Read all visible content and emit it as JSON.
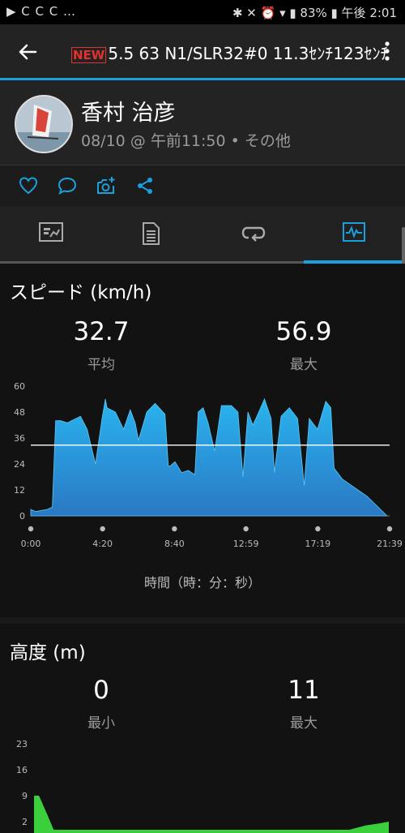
{
  "status_bar": {
    "left_icons": "▶ C C C …",
    "battery": "83%",
    "time": "午後 2:01"
  },
  "app_bar": {
    "badge": "NEW",
    "title": "5.5 63 N1/SLR32#0 11.3ｾﾝﾁ123ｾﾝﾁ"
  },
  "activity": {
    "user_name": "香村 治彦",
    "subtitle": "08/10 @ 午前11:50 • その他"
  },
  "actions": [
    "heart-icon",
    "comment-icon",
    "camera-add-icon",
    "share-icon"
  ],
  "tabs": [
    {
      "icon": "summary-icon",
      "active": false
    },
    {
      "icon": "details-icon",
      "active": false
    },
    {
      "icon": "laps-icon",
      "active": false
    },
    {
      "icon": "charts-icon",
      "active": true
    }
  ],
  "speed": {
    "title": "スピード (km/h)",
    "avg_value": "32.7",
    "avg_label": "平均",
    "max_value": "56.9",
    "max_label": "最大",
    "x_axis_label": "時間（時：分：秒）"
  },
  "altitude": {
    "title": "高度 (m)",
    "min_value": "0",
    "min_label": "最小",
    "max_value": "11",
    "max_label": "最大"
  },
  "colors": {
    "accent": "#1aa0dc",
    "speed_fill": "#2a8fd0",
    "altitude_fill": "#3ccf3c"
  },
  "chart_data": [
    {
      "type": "area",
      "ylim": [
        0,
        60
      ],
      "yticks": [
        "0",
        "12",
        "24",
        "36",
        "48",
        "60"
      ],
      "xticks": [
        "0:00",
        "4:20",
        "8:40",
        "12:59",
        "17:19",
        "21:39"
      ],
      "x_minutes": [
        0,
        0.3,
        1,
        1.3,
        1.5,
        1.8,
        2.2,
        3.0,
        3.4,
        3.9,
        4.3,
        4.5,
        4.6,
        5.1,
        5.6,
        6.0,
        6.3,
        6.5,
        7.0,
        7.5,
        8.1,
        8.3,
        8.4,
        8.7,
        9.1,
        9.5,
        9.9,
        10.1,
        10.4,
        10.7,
        11.1,
        11.5,
        12.1,
        12.5,
        12.8,
        13.1,
        13.4,
        13.7,
        14.1,
        14.5,
        14.7,
        15.1,
        15.6,
        16.1,
        16.5,
        16.8,
        17.3,
        17.8,
        18.1,
        18.3,
        18.8,
        20.3,
        21.5
      ],
      "y_kmh": [
        3,
        2,
        3,
        4,
        44,
        44,
        43,
        46,
        40,
        24,
        45,
        54,
        50,
        48,
        40,
        49,
        43,
        35,
        48,
        52,
        47,
        23,
        23,
        25,
        20,
        21,
        19,
        48,
        50,
        43,
        30,
        51,
        51,
        48,
        18,
        48,
        42,
        47,
        54,
        45,
        20,
        46,
        50,
        45,
        14,
        45,
        40,
        53,
        50,
        22,
        17,
        9,
        0
      ],
      "reference_line": 32.7
    },
    {
      "type": "area",
      "ylim": [
        0,
        23
      ],
      "yticks": [
        "2",
        "9",
        "16",
        "23"
      ],
      "x_minutes": [
        0,
        0.3,
        0.8,
        1.2,
        1.4,
        2.0,
        4.0,
        8.0,
        12.0,
        16.0,
        18.0,
        19.2,
        20.2,
        21.0,
        21.6
      ],
      "y_m": [
        9,
        9,
        4,
        0,
        0,
        0,
        0,
        0,
        0,
        0,
        0,
        0,
        1,
        1.5,
        2
      ]
    }
  ]
}
